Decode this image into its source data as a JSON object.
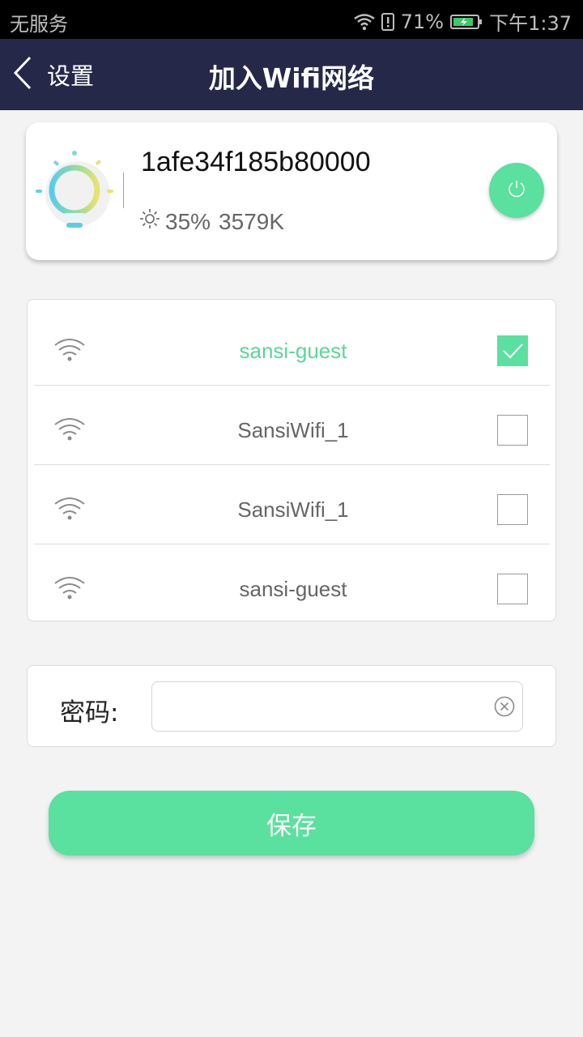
{
  "status_bar": {
    "carrier": "无服务",
    "battery": "71%",
    "time": "下午1:37"
  },
  "nav": {
    "back_label": "设置",
    "title": "加入Wifi网络"
  },
  "device": {
    "name": "1afe34f185b80000",
    "brightness": "35%",
    "color_temp": "3579K"
  },
  "wifi_networks": [
    {
      "ssid": "sansi-guest",
      "selected": true
    },
    {
      "ssid": "SansiWifi_1",
      "selected": false
    },
    {
      "ssid": "SansiWifi_1",
      "selected": false
    },
    {
      "ssid": "sansi-guest",
      "selected": false
    }
  ],
  "password": {
    "label": "密码:",
    "value": ""
  },
  "save_label": "保存",
  "colors": {
    "accent": "#5ae09f",
    "navbar": "#252848",
    "background": "#f3f3f3"
  }
}
